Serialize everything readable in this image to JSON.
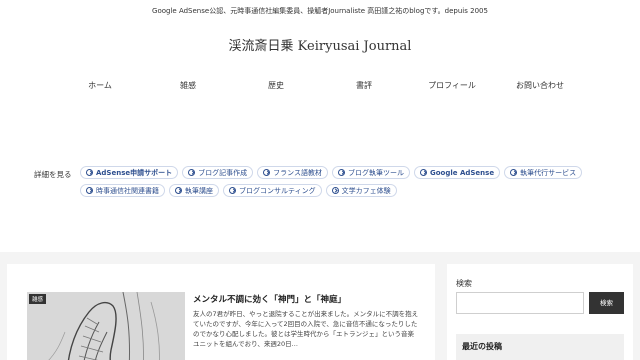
{
  "header": {
    "tagline": "Google AdSense公認、元時事通信社編集委員、操觚者Journaliste 高田謹之祐のblogです。depuis 2005",
    "site_title": "渓流斎日乗 Keiryusai Journal"
  },
  "nav": {
    "items": [
      "ホーム",
      "雑感",
      "歴史",
      "書評",
      "プロフィール",
      "お問い合わせ"
    ]
  },
  "tags": {
    "label": "詳細を見る",
    "row1": [
      "AdSense申請サポート",
      "ブログ記事作成",
      "フランス語教材",
      "ブログ執筆ツール",
      "Google AdSense",
      "執筆代行サービス"
    ],
    "row2": [
      "時事通信社関連書籍",
      "執筆講座",
      "ブログコンサルティング",
      "文学カフェ体験"
    ]
  },
  "post": {
    "category": "雑感",
    "title": "メンタル不調に効く「神門」と「神庭」",
    "excerpt": "友人の7君が昨日、やっと退院することが出来ました。メンタルに不調を抱えていたのですが、今年に入って2回目の入院で、急に音信不通になったりしたのでかなり心配しました。彼とは学生時代から「エトランジェ」という音楽ユニットを組んでおり、来週20日..."
  },
  "sidebar": {
    "search_label": "検索",
    "search_placeholder": "",
    "search_button": "検索",
    "recent_heading": "最近の投稿"
  }
}
